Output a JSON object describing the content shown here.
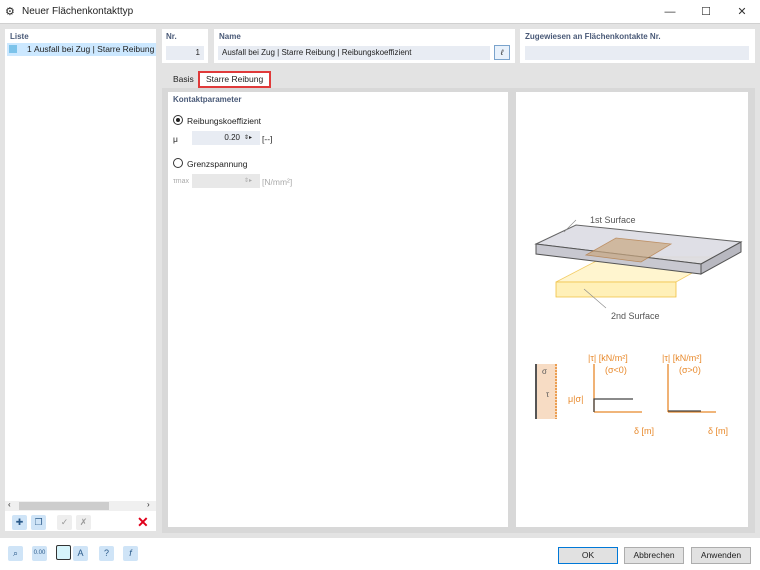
{
  "window": {
    "title": "Neuer Flächenkontakttyp",
    "minimize": "—",
    "maximize": "☐",
    "close": "✕"
  },
  "list": {
    "header": "Liste",
    "items": [
      {
        "number": "1",
        "label": "Ausfall bei Zug | Starre Reibung | Reibungskoeffizient"
      }
    ],
    "toolbar": [
      "new-icon",
      "copy-icon",
      "check-icon",
      "uncheck-icon",
      "delete-icon"
    ]
  },
  "nr": {
    "label": "Nr.",
    "value": "1"
  },
  "name": {
    "label": "Name",
    "value": "Ausfall bei Zug | Starre Reibung | Reibungskoeffizient"
  },
  "assigned": {
    "label": "Zugewiesen an Flächenkontakte Nr.",
    "value": ""
  },
  "tabs": [
    {
      "label": "Basis",
      "active": false
    },
    {
      "label": "Starre Reibung",
      "active": true
    }
  ],
  "params": {
    "header": "Kontaktparameter",
    "friction": {
      "label": "Reibungskoeffizient",
      "selected": true,
      "symbol": "μ",
      "value": "0.20",
      "unit": "[--]"
    },
    "limit": {
      "label": "Grenzspannung",
      "selected": false,
      "symbol": "τmax",
      "value": "",
      "unit": "[N/mm²]"
    }
  },
  "diagram": {
    "surface1": "1st Surface",
    "surface2": "2nd Surface",
    "graph1": {
      "ylabel": "|τ| [kN/m²]",
      "cond": "(σ<0)",
      "level": "μ|σ|",
      "xlabel": "δ [m]"
    },
    "graph2": {
      "ylabel": "|τ| [kN/m²]",
      "cond": "(σ>0)",
      "xlabel": "δ [m]"
    },
    "sigma": "σ",
    "tau": "τ",
    "accent": "#e8892b"
  },
  "footer": {
    "icons": [
      "search-icon",
      "units-icon",
      "display-icon",
      "section-icon",
      "help-icon",
      "formula-icon"
    ],
    "ok": "OK",
    "cancel": "Abbrechen",
    "apply": "Anwenden"
  }
}
